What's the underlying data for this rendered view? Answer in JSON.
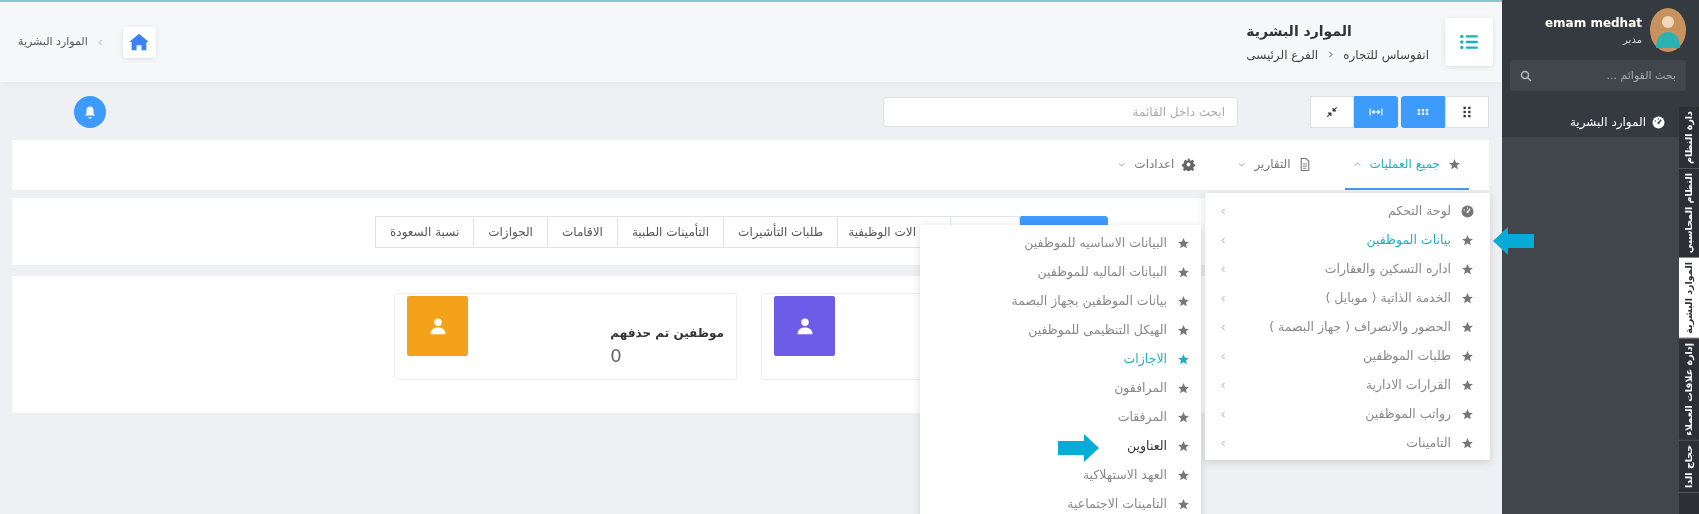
{
  "header": {
    "breadcrumb": "الموارد البشرية",
    "title": "الموارد البشرية",
    "path": [
      "انفوساس للتجاره",
      "الفرع الرئيسى"
    ]
  },
  "toolbar": {
    "search": {
      "placeholder": "ابحث داخل القائمة"
    },
    "view_buttons": [
      {
        "kind": "grid-large",
        "selected": false
      },
      {
        "kind": "grid-small",
        "selected": true
      },
      {
        "kind": "fit-width",
        "selected": true
      },
      {
        "kind": "compress",
        "selected": false
      }
    ]
  },
  "menu_tabs": [
    {
      "kind": "star",
      "label": "جميع العمليات",
      "selected": true,
      "expanded": true
    },
    {
      "kind": "file",
      "label": "التقارير",
      "selected": false,
      "expanded": false
    },
    {
      "kind": "gear",
      "label": "اعدادات",
      "selected": false,
      "expanded": false
    }
  ],
  "sub_tabs": [
    {
      "selected": true
    },
    {
      "selected": false
    },
    {
      "label": "الات الوظيفية",
      "selected": false
    },
    {
      "label": "طلبات التأشيرات",
      "selected": false
    },
    {
      "label": "التأمينات الطبية",
      "selected": false
    },
    {
      "label": "الاقامات",
      "selected": false
    },
    {
      "label": "الجوازات",
      "selected": false
    },
    {
      "label": "نسبة السعودة",
      "selected": false
    }
  ],
  "stat_cards": [
    {
      "color": "#6c5ce7"
    },
    {
      "color": "#f5a21b",
      "title": "موظفين تم حذفهم",
      "value": "0"
    }
  ],
  "dropdown": {
    "items": [
      {
        "kind": "gauge",
        "label": "لوحة التحكم",
        "selected": false
      },
      {
        "kind": "star",
        "label": "بيانات الموظفين",
        "selected": true
      },
      {
        "kind": "star",
        "label": "اداره التسكين والعقارات",
        "selected": false
      },
      {
        "kind": "star",
        "label": "الخدمة الذاتية ( موبايل )",
        "selected": false
      },
      {
        "kind": "star",
        "label": "الحضور والانصراف ( جهاز البصمة )",
        "selected": false
      },
      {
        "kind": "star",
        "label": "طلبات الموظفين",
        "selected": false
      },
      {
        "kind": "star",
        "label": "القرارات الادارية",
        "selected": false
      },
      {
        "kind": "star",
        "label": "رواتب الموظفين",
        "selected": false
      },
      {
        "kind": "star",
        "label": "التامينات",
        "selected": false
      }
    ]
  },
  "submenu": {
    "items": [
      {
        "label": "البيانات الاساسيه للموظفين",
        "selected": false,
        "hovered": false
      },
      {
        "label": "البيانات الماليه للموظفين",
        "selected": false,
        "hovered": false
      },
      {
        "label": "بيانات الموظفين بجهاز البصمة",
        "selected": false,
        "hovered": false
      },
      {
        "label": "الهيكل التنظيمى للموظفين",
        "selected": false,
        "hovered": false
      },
      {
        "label": "الاجازات",
        "selected": true,
        "hovered": false
      },
      {
        "label": "المرافقون",
        "selected": false,
        "hovered": false
      },
      {
        "label": "المرفقات",
        "selected": false,
        "hovered": false
      },
      {
        "label": "العناوين",
        "selected": false,
        "hovered": true
      },
      {
        "label": "العهد الاستهلاكية",
        "selected": false,
        "hovered": false
      },
      {
        "label": "التامينات الاجتماعية",
        "selected": false,
        "hovered": false
      }
    ]
  },
  "sidebar": {
    "user": {
      "name": "emam medhat",
      "role": "مدير"
    },
    "search": {
      "placeholder": "بحث القوائم ..."
    },
    "module": "الموارد البشرية",
    "side_tabs": [
      {
        "label": "دارة النظام",
        "selected": false
      },
      {
        "label": "النظام المحاسبي",
        "selected": false
      },
      {
        "label": "الموارد البشرية",
        "selected": true
      },
      {
        "label": "إدارة علاقات العملاء",
        "selected": false
      },
      {
        "label": "حجاج الدا",
        "selected": false
      }
    ]
  }
}
